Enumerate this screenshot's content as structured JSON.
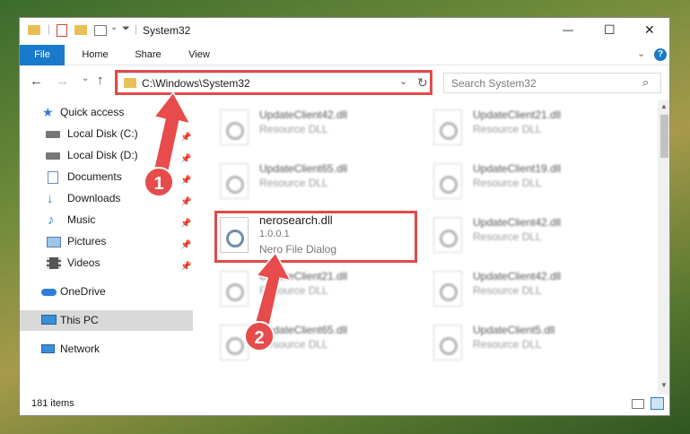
{
  "window": {
    "title": "System32",
    "min": "—",
    "max": "☐",
    "close": "✕"
  },
  "ribbon": {
    "tabs": [
      "File",
      "Home",
      "Share",
      "View"
    ],
    "expand": "⌄",
    "help": "?"
  },
  "nav": {
    "back": "←",
    "forward": "→",
    "recent": "⌄",
    "up": "↑",
    "address": "C:\\Windows\\System32",
    "address_dropdown": "⌄",
    "refresh": "↻",
    "search_placeholder": "Search System32"
  },
  "sidebar": {
    "items": [
      {
        "label": "Quick access",
        "icon": "star-icon",
        "pinned": false
      },
      {
        "label": "Local Disk (C:)",
        "icon": "drive-icon",
        "pinned": true
      },
      {
        "label": "Local Disk (D:)",
        "icon": "drive-icon",
        "pinned": true
      },
      {
        "label": "Documents",
        "icon": "documents-icon",
        "pinned": true
      },
      {
        "label": "Downloads",
        "icon": "download-icon",
        "pinned": true
      },
      {
        "label": "Music",
        "icon": "music-icon",
        "pinned": true
      },
      {
        "label": "Pictures",
        "icon": "pictures-icon",
        "pinned": true
      },
      {
        "label": "Videos",
        "icon": "videos-icon",
        "pinned": true
      },
      {
        "label": "OneDrive",
        "icon": "cloud-icon",
        "pinned": false
      },
      {
        "label": "This PC",
        "icon": "computer-icon",
        "pinned": false,
        "selected": true
      },
      {
        "label": "Network",
        "icon": "network-icon",
        "pinned": false
      }
    ]
  },
  "files": {
    "left": [
      {
        "name": "UpdateClient42.dll",
        "type": "Resource DLL"
      },
      {
        "name": "UpdateClient65.dll",
        "type": "Resource DLL"
      },
      {
        "name": "nerosearch.dll",
        "version": "1.0.0.1",
        "type": "Nero File Dialog"
      },
      {
        "name": "UpdateClient21.dll",
        "type": "Resource DLL"
      },
      {
        "name": "UpdateClient65.dll",
        "type": "Resource DLL"
      }
    ],
    "right": [
      {
        "name": "UpdateClient21.dll",
        "type": "Resource DLL"
      },
      {
        "name": "UpdateClient19.dll",
        "type": "Resource DLL"
      },
      {
        "name": "UpdateClient42.dll",
        "type": "Resource DLL"
      },
      {
        "name": "UpdateClient42.dll",
        "type": "Resource DLL"
      },
      {
        "name": "UpdateClient5.dll",
        "type": "Resource DLL"
      }
    ]
  },
  "status": {
    "count": "181 items"
  },
  "annotations": {
    "badge1": "1",
    "badge2": "2"
  },
  "colors": {
    "file_tab": "#1979ca",
    "highlight": "#e04a4a",
    "selected": "#d9d9d9"
  }
}
